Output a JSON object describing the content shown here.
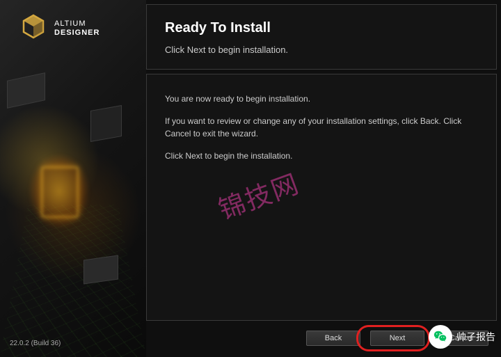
{
  "brand": {
    "line1": "ALTIUM",
    "line2": "DESIGNER"
  },
  "version": "22.0.2 (Build 36)",
  "header": {
    "title": "Ready To Install",
    "subtitle": "Click Next to begin installation."
  },
  "body": {
    "p1": "You are now ready to begin installation.",
    "p2": "If you want to review or change any of your installation settings, click Back. Click Cancel to exit the wizard.",
    "p3": "Click Next to begin the installation."
  },
  "watermark": "锦技网",
  "buttons": {
    "back": "Back",
    "next": "Next",
    "cancel": "Cancel"
  },
  "overlay": {
    "label": "帅子报告"
  }
}
